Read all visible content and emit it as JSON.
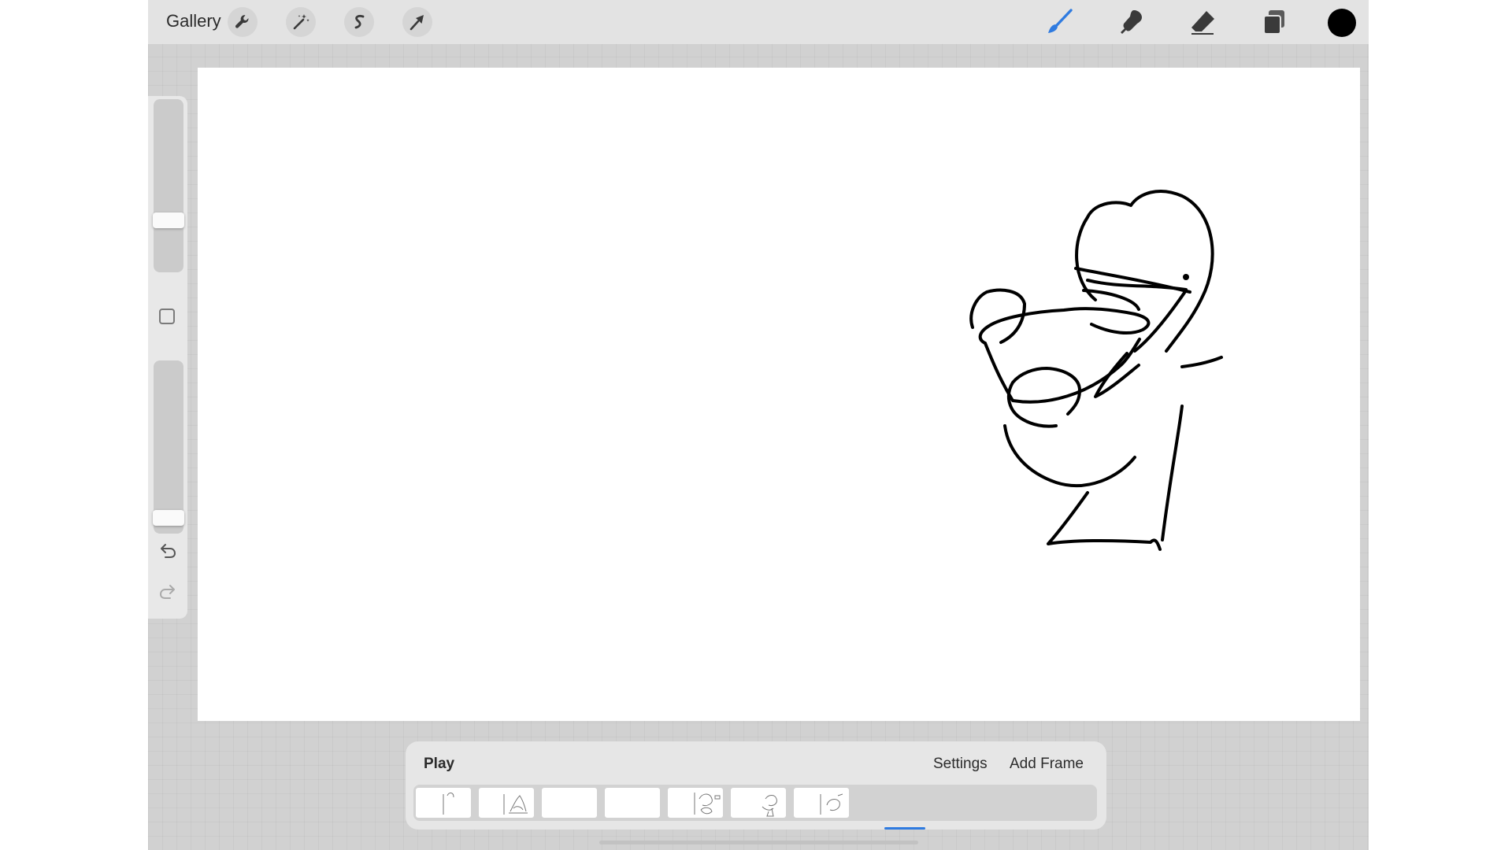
{
  "topbar": {
    "gallery_label": "Gallery",
    "left_tools": [
      {
        "name": "actions",
        "icon": "wrench-icon"
      },
      {
        "name": "adjustments",
        "icon": "magic-wand-icon"
      },
      {
        "name": "selection",
        "icon": "selection-s-icon"
      },
      {
        "name": "transform",
        "icon": "arrow-cursor-icon"
      }
    ],
    "right_tools": [
      {
        "name": "brush",
        "icon": "brush-icon",
        "active": true
      },
      {
        "name": "smudge",
        "icon": "smudge-icon"
      },
      {
        "name": "eraser",
        "icon": "eraser-icon"
      },
      {
        "name": "layers",
        "icon": "layers-icon"
      }
    ],
    "active_color": "#000000",
    "accent_color": "#2f7be0"
  },
  "sidebar": {
    "brush_size_level": 0.28,
    "opacity_level": 0.05
  },
  "animation": {
    "play_label": "Play",
    "settings_label": "Settings",
    "add_frame_label": "Add Frame",
    "frame_count": 7,
    "selected_frame": 6
  }
}
